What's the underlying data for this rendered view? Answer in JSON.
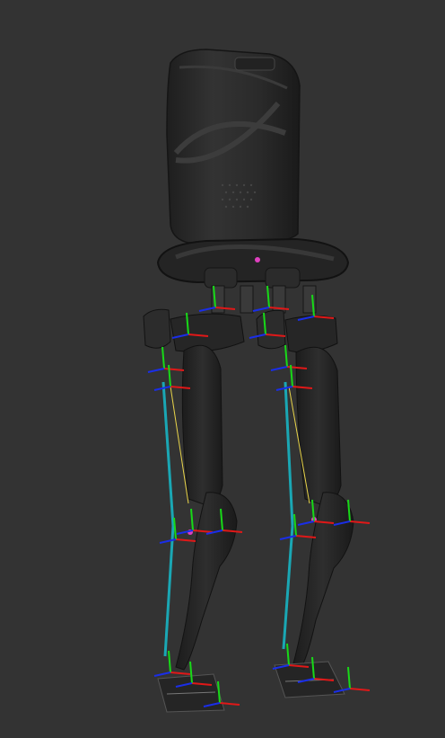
{
  "viewport": {
    "background": "#333333"
  },
  "model": {
    "colors": {
      "body": "#272727",
      "body_highlight": "#3d3d3d",
      "body_edge": "#151515",
      "axis_x": "#e01818",
      "axis_y": "#18d818",
      "axis_z": "#1a2ee8",
      "tendon": "#1aa7b4",
      "wire": "#e8d44a",
      "marker": "#e040c0"
    }
  }
}
